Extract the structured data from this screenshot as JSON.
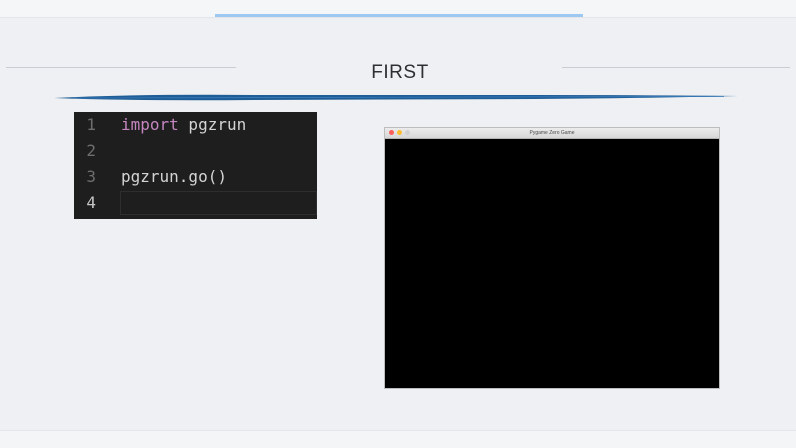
{
  "slide": {
    "title": "FIRST"
  },
  "editor": {
    "lines": [
      {
        "number": "1",
        "keyword": "import",
        "rest": " pgzrun"
      },
      {
        "number": "2",
        "keyword": "",
        "rest": ""
      },
      {
        "number": "3",
        "keyword": "",
        "rest": "pgzrun.go()"
      },
      {
        "number": "4",
        "keyword": "",
        "rest": ""
      }
    ],
    "active_line": "4",
    "keyword_color": "#c586c0",
    "text_color": "#d4d4d4",
    "background_color": "#1e1e1e"
  },
  "game_window": {
    "title": "Pygame Zero Game",
    "canvas_color": "#000000",
    "buttons": [
      "close-icon",
      "minimize-icon",
      "maximize-icon"
    ]
  },
  "colors": {
    "accent_top": "#9cc8f2",
    "brush_stroke": "#1f5d96",
    "background": "#eef0f3"
  }
}
